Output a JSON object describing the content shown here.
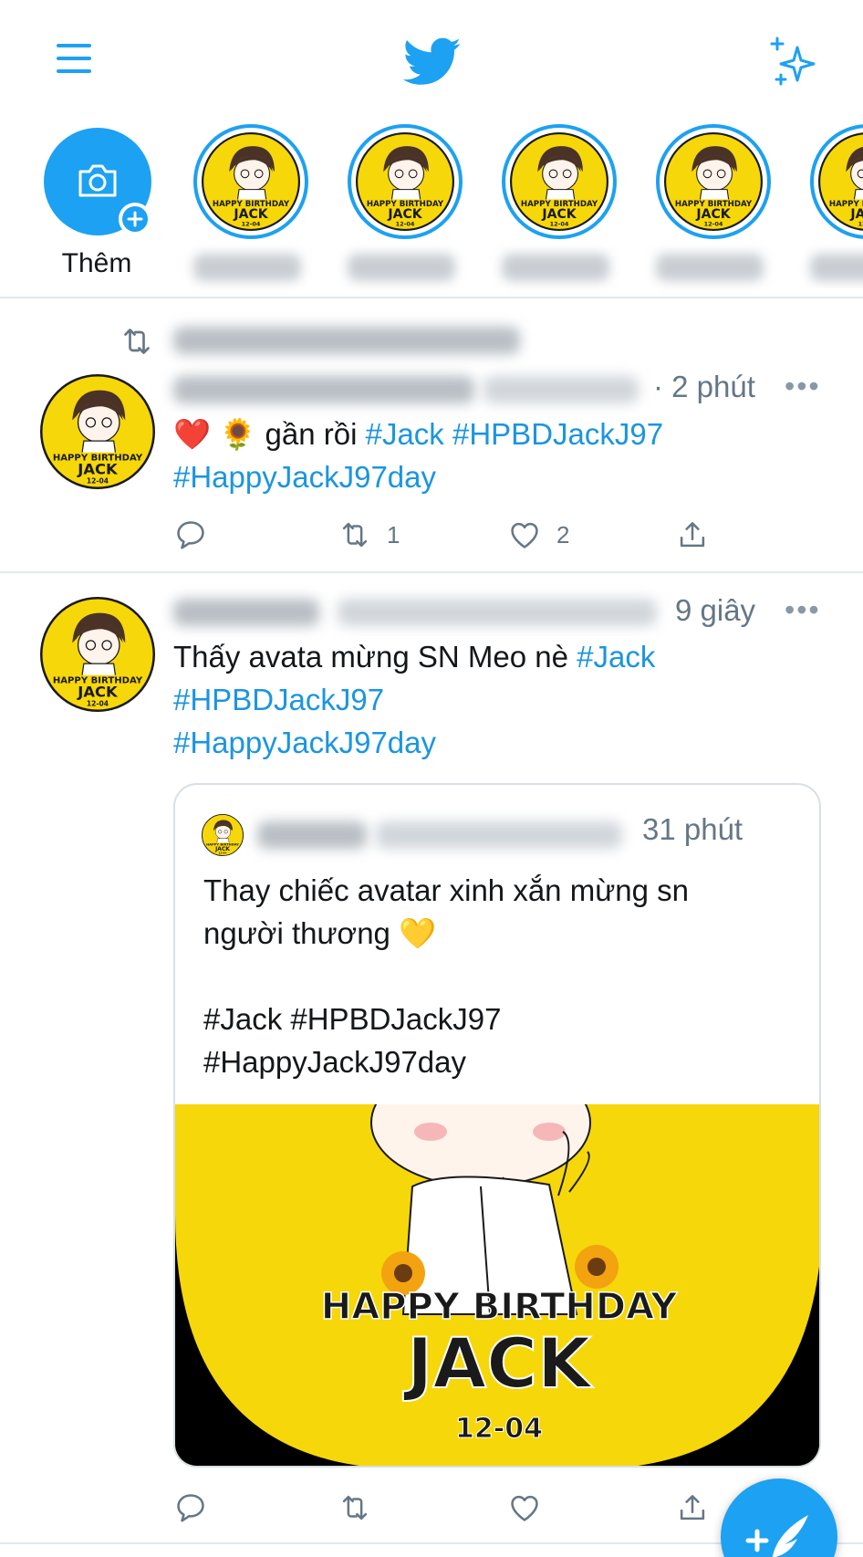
{
  "app": {
    "name": "Twitter",
    "accent_color": "#1da1f2",
    "brand_color": "#1b95e0"
  },
  "header": {
    "menu_icon": "hamburger-menu-icon",
    "logo_icon": "twitter-bird-icon",
    "sparkle_icon": "sparkle-icon"
  },
  "fleets": {
    "add_label": "Thêm",
    "items": [
      {
        "avatar": "happy-birthday-jack-avatar"
      },
      {
        "avatar": "happy-birthday-jack-avatar"
      },
      {
        "avatar": "happy-birthday-jack-avatar"
      },
      {
        "avatar": "happy-birthday-jack-avatar"
      },
      {
        "avatar": "happy-birthday-jack-avatar"
      }
    ]
  },
  "tweets": [
    {
      "retweeted": true,
      "time": "· 2 phút",
      "text_prefix": "❤️ 🌻 gần rồi",
      "tag_1": "#Jack",
      "tag_2": "#HPBDJackJ97",
      "tag_3": "#HappyJackJ97day",
      "replies": "",
      "retweets": "1",
      "likes": "2"
    },
    {
      "retweeted": false,
      "time": "9 giây",
      "text_prefix": "Thấy avata mừng SN Meo nè",
      "tag_1": "#Jack",
      "tag_2": "#HPBDJackJ97",
      "tag_3": "#HappyJackJ97day",
      "quote": {
        "time": "31 phút",
        "text": "Thay chiếc avatar xinh xắn mừng sn\nngười thương 💛\n\n#Jack #HPBDJackJ97\n#HappyJackJ97day",
        "image": {
          "line_1": "HAPPY BIRTHDAY",
          "line_2": "JACK",
          "line_3": "12-04"
        }
      }
    }
  ],
  "more_label": "•••",
  "fab": {
    "icon": "compose-tweet-icon",
    "plus": "+"
  }
}
